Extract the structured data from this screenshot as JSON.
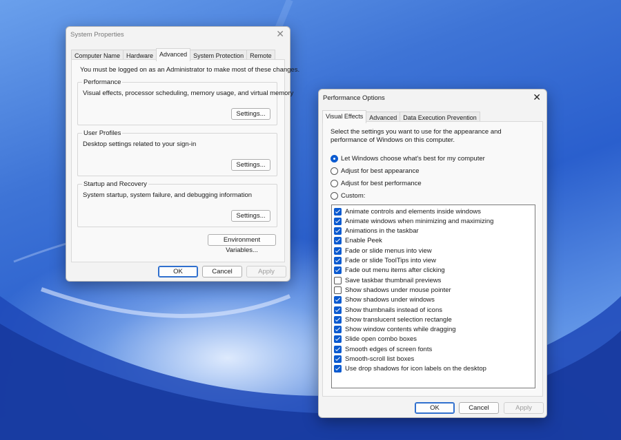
{
  "system_properties": {
    "title": "System Properties",
    "close_glyph": "✕",
    "tabs": [
      {
        "label": "Computer Name",
        "active": false
      },
      {
        "label": "Hardware",
        "active": false
      },
      {
        "label": "Advanced",
        "active": true
      },
      {
        "label": "System Protection",
        "active": false
      },
      {
        "label": "Remote",
        "active": false
      }
    ],
    "admin_notice": "You must be logged on as an Administrator to make most of these changes.",
    "groups": [
      {
        "title": "Performance",
        "description": "Visual effects, processor scheduling, memory usage, and virtual memory",
        "button": "Settings..."
      },
      {
        "title": "User Profiles",
        "description": "Desktop settings related to your sign-in",
        "button": "Settings..."
      },
      {
        "title": "Startup and Recovery",
        "description": "System startup, system failure, and debugging information",
        "button": "Settings..."
      }
    ],
    "env_button": "Environment Variables...",
    "buttons": {
      "ok": "OK",
      "cancel": "Cancel",
      "apply": "Apply"
    }
  },
  "performance_options": {
    "title": "Performance Options",
    "close_glyph": "✕",
    "tabs": [
      {
        "label": "Visual Effects",
        "active": true
      },
      {
        "label": "Advanced",
        "active": false
      },
      {
        "label": "Data Execution Prevention",
        "active": false
      }
    ],
    "intro_line1": "Select the settings you want to use for the appearance and",
    "intro_line2": "performance of Windows on this computer.",
    "radios": [
      {
        "label": "Let Windows choose what's best for my computer",
        "selected": true
      },
      {
        "label": "Adjust for best appearance",
        "selected": false
      },
      {
        "label": "Adjust for best performance",
        "selected": false
      },
      {
        "label": "Custom:",
        "selected": false
      }
    ],
    "effects": [
      {
        "label": "Animate controls and elements inside windows",
        "checked": true
      },
      {
        "label": "Animate windows when minimizing and maximizing",
        "checked": true
      },
      {
        "label": "Animations in the taskbar",
        "checked": true
      },
      {
        "label": "Enable Peek",
        "checked": true
      },
      {
        "label": "Fade or slide menus into view",
        "checked": true
      },
      {
        "label": "Fade or slide ToolTips into view",
        "checked": true
      },
      {
        "label": "Fade out menu items after clicking",
        "checked": true
      },
      {
        "label": "Save taskbar thumbnail previews",
        "checked": false
      },
      {
        "label": "Show shadows under mouse pointer",
        "checked": false
      },
      {
        "label": "Show shadows under windows",
        "checked": true
      },
      {
        "label": "Show thumbnails instead of icons",
        "checked": true
      },
      {
        "label": "Show translucent selection rectangle",
        "checked": true
      },
      {
        "label": "Show window contents while dragging",
        "checked": true
      },
      {
        "label": "Slide open combo boxes",
        "checked": true
      },
      {
        "label": "Smooth edges of screen fonts",
        "checked": true
      },
      {
        "label": "Smooth-scroll list boxes",
        "checked": true
      },
      {
        "label": "Use drop shadows for icon labels on the desktop",
        "checked": true
      }
    ],
    "buttons": {
      "ok": "OK",
      "cancel": "Cancel",
      "apply": "Apply"
    }
  }
}
